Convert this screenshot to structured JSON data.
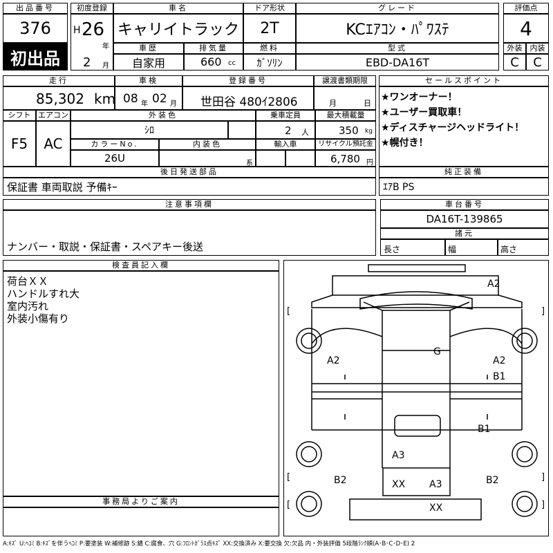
{
  "sheet": {
    "lot": {
      "label": "出品番号",
      "value": "376",
      "badge": "初出品"
    },
    "first_reg": {
      "label": "初度登録",
      "era": "H",
      "year": "26",
      "year_unit": "年",
      "month": "2",
      "month_unit": "月"
    },
    "car_name": {
      "label": "車名",
      "value": "キャリイトラック"
    },
    "doors": {
      "label": "ドア形状",
      "value": "2T"
    },
    "grade": {
      "label": "グレード",
      "value": "KCｴｱｺﾝ・ﾊﾟﾜｽﾃ"
    },
    "score": {
      "label": "評価点",
      "value": "4"
    },
    "history": {
      "label": "車歴",
      "value": "自家用"
    },
    "displacement": {
      "label": "排気量",
      "value": "660",
      "unit": "cc"
    },
    "fuel": {
      "label": "燃料",
      "value": "ｶﾞｿﾘﾝ"
    },
    "model": {
      "label": "型式",
      "value": "EBD-DA16T"
    },
    "exterior_grade": {
      "label": "外装",
      "value": "C"
    },
    "interior_grade": {
      "label": "内装",
      "value": "C"
    },
    "mileage": {
      "label": "走行",
      "value": "85,302",
      "unit": "km"
    },
    "inspection": {
      "label": "車検",
      "year": "08",
      "year_unit": "年",
      "month": "02",
      "month_unit": "月"
    },
    "plate": {
      "label": "登録番号",
      "value": "世田谷 480ｲ2806"
    },
    "transfer": {
      "label": "譲渡書類期限",
      "month_unit": "月",
      "day_unit": "日"
    },
    "shift": {
      "label": "シフト",
      "value": "F5"
    },
    "aircon": {
      "label": "エアコン",
      "value": "AC"
    },
    "color": {
      "label": "外装色",
      "value": "ｼﾛ"
    },
    "capacity": {
      "label": "乗車定員",
      "value": "2",
      "unit": "人"
    },
    "max_load": {
      "label": "最大積載量",
      "value": "350",
      "unit": "kg"
    },
    "color_no": {
      "label": "カラーNo.",
      "value": "26U"
    },
    "interior_color": {
      "label": "内装色",
      "unit": "系"
    },
    "import": {
      "label": "輸入車"
    },
    "recycle": {
      "label": "リサイクル預託金",
      "value": "6,780",
      "unit": "円"
    },
    "sales_points": {
      "label": "セールスポイント",
      "items": [
        "★ワンオーナー！",
        "★ユーザー買取車！",
        "★ディスチャージヘッドライト！",
        "★幌付き！"
      ]
    },
    "later_parts": {
      "label": "後日発送部品",
      "value": "保証書 車両取説 予備ｷｰ"
    },
    "equipment": {
      "label": "純正装備",
      "value": "ｴｱB PS"
    },
    "notes": {
      "label": "注意事項欄",
      "value": "ナンバー・取説・保証書・スペアキー後送"
    },
    "chassis": {
      "label": "車台番号",
      "value": "DA16T-139865"
    },
    "dims": {
      "label": "諸元",
      "length": "長さ",
      "width": "幅",
      "height": "高さ"
    },
    "inspector": {
      "label": "検査員記入欄",
      "lines": [
        "荷台ＸＸ",
        "ハンドルすれ大",
        "室内汚れ",
        "外装小傷有り"
      ]
    },
    "office": {
      "label": "事務局よりご案内"
    },
    "diagram": {
      "marks": [
        "A2",
        "A2",
        "A2",
        "B1",
        "G",
        "B1",
        "A3",
        "B2",
        "B2",
        "XX",
        "A3",
        "XX"
      ],
      "brackets": [
        "[",
        "]",
        "[",
        "]",
        "[",
        "]"
      ]
    },
    "legend": "A:ｷｽﾞ U:ﾍｺﾐ B:ｷｽﾞを伴うﾍｺﾐ P:要塗装 W:補修跡 S:錆 C:腐食、穴 G:ﾌﾛﾝﾄｶﾞﾗｽ点ｷｽﾞ XX:交換済み X:要交換 欠:欠品 内・外装評価 5段階ﾗﾝｸ順(A･B･C･D･E) 2"
  }
}
